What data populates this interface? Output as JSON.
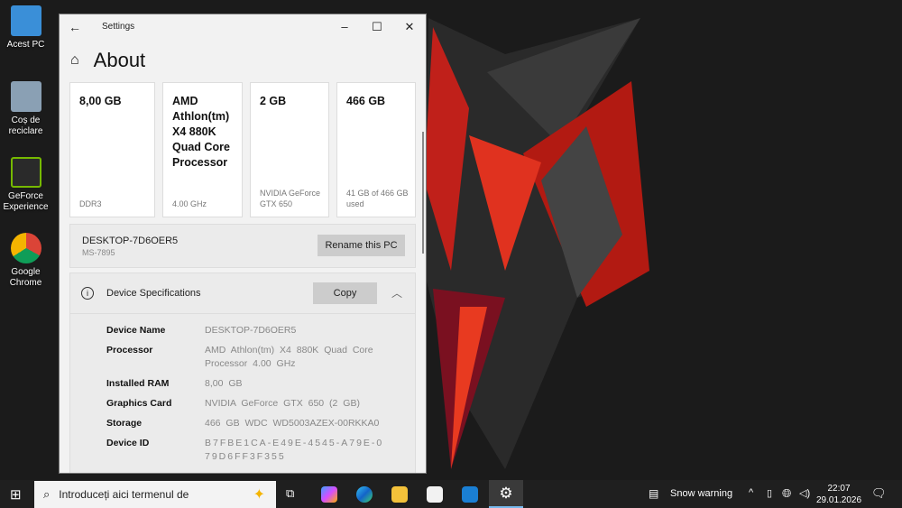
{
  "desktop": {
    "icons": [
      {
        "label": "Acest PC"
      },
      {
        "label": "Coș de reciclare"
      },
      {
        "label": "GeForce Experience"
      },
      {
        "label": "Google Chrome"
      }
    ]
  },
  "window": {
    "title": "Settings",
    "page_title": "About",
    "cards": [
      {
        "value": "8,00 GB",
        "detail": "DDR3"
      },
      {
        "value": "AMD Athlon(tm) X4 880K Quad Core Processor",
        "detail": "4.00 GHz"
      },
      {
        "value": "2 GB",
        "detail": "NVIDIA GeForce GTX 650"
      },
      {
        "value": "466 GB",
        "detail": "41 GB of 466 GB used"
      }
    ],
    "pc_name": "DESKTOP-7D6OER5",
    "pc_model": "MS-7895",
    "rename_label": "Rename this PC",
    "specs_title": "Device Specifications",
    "copy_label": "Copy",
    "specs": [
      {
        "key": "Device Name",
        "value": "DESKTOP-7D6OER5"
      },
      {
        "key": "Processor",
        "value": "AMD Athlon(tm) X4 880K Quad Core Processor 4.00 GHz"
      },
      {
        "key": "Installed RAM",
        "value": "8,00 GB"
      },
      {
        "key": "Graphics Card",
        "value": "NVIDIA GeForce GTX 650 (2 GB)"
      },
      {
        "key": "Storage",
        "value": "466 GB WDC WD5003AZEX-00RKKA0"
      },
      {
        "key": "Device ID",
        "value": "B7FBE1CA-E49E-4545-A79E-079D6FF3F355"
      }
    ]
  },
  "taskbar": {
    "search_placeholder": "Introduceți aici termenul de",
    "weather": "Snow warning",
    "time": "22:07",
    "date": "29.01.2026"
  }
}
